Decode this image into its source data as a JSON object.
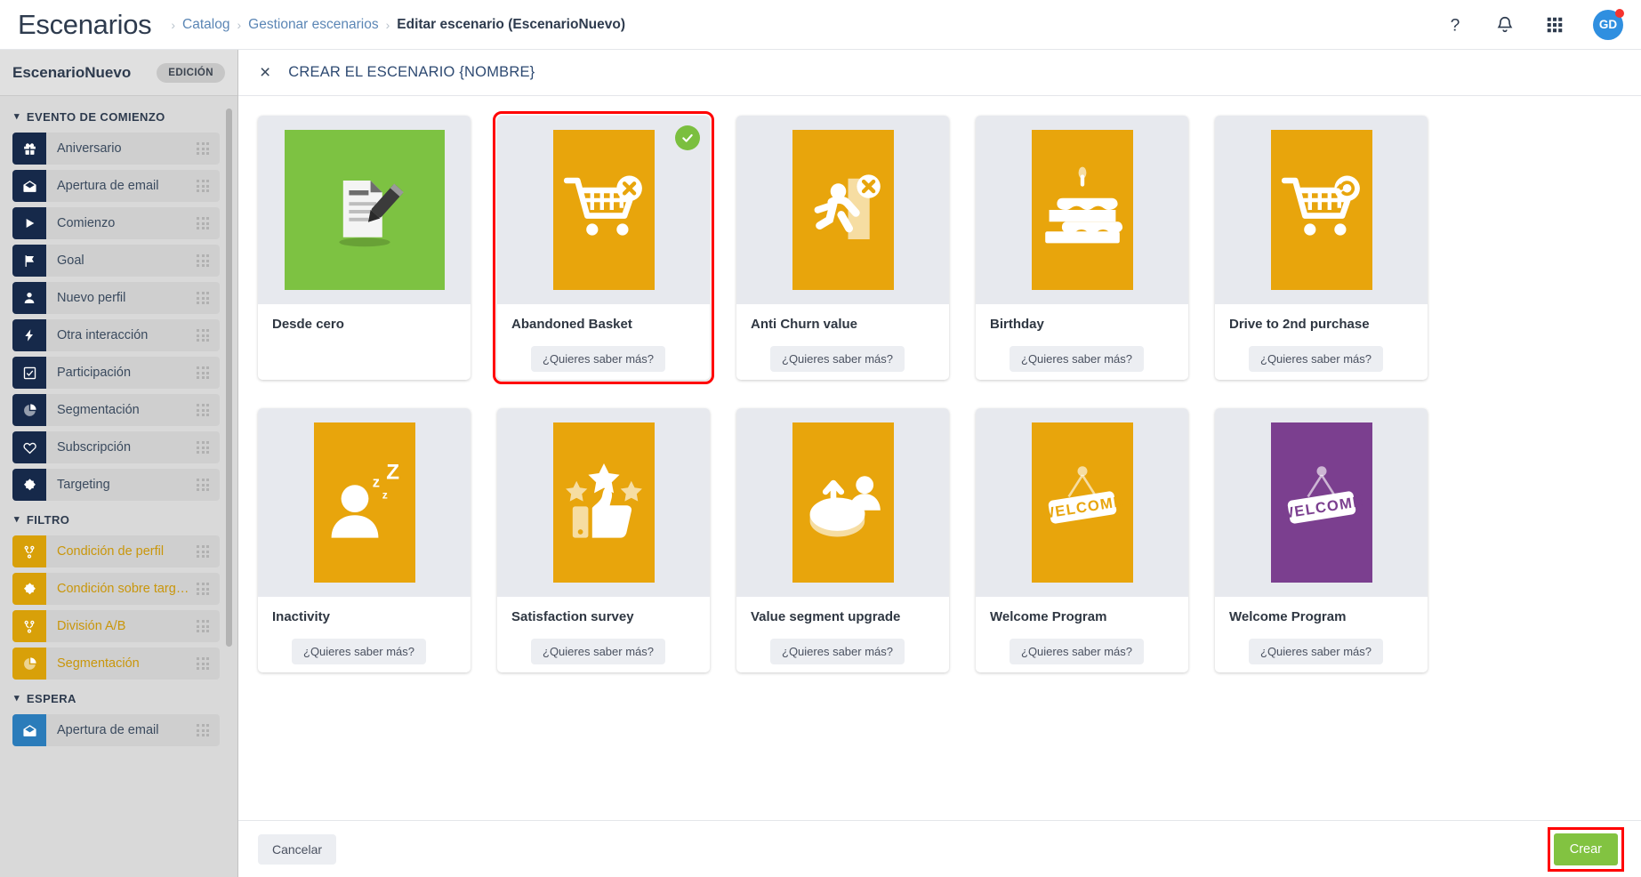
{
  "header": {
    "app_title": "Escenarios",
    "breadcrumb": [
      {
        "label": "Catalog",
        "active": false
      },
      {
        "label": "Gestionar escenarios",
        "active": false
      },
      {
        "label": "Editar escenario (EscenarioNuevo)",
        "active": true
      }
    ],
    "separator": "›",
    "actions": [
      {
        "name": "help-icon",
        "glyph": "?"
      },
      {
        "name": "notifications-bell-icon",
        "glyph": "bell"
      },
      {
        "name": "app-grid-icon",
        "glyph": "grid"
      }
    ],
    "avatar": {
      "initials": "GD",
      "color": "#2f8fe0",
      "dot_color": "#f6332e"
    }
  },
  "sidebar": {
    "scenario_name": "EscenarioNuevo",
    "edition_badge": "EDICIÓN",
    "groups": [
      {
        "title": "EVENTO DE COMIENZO",
        "kind": "evt",
        "items": [
          {
            "label": "Aniversario",
            "icon": "gift-icon"
          },
          {
            "label": "Apertura de email",
            "icon": "envelope-open-icon"
          },
          {
            "label": "Comienzo",
            "icon": "play-icon"
          },
          {
            "label": "Goal",
            "icon": "flag-icon"
          },
          {
            "label": "Nuevo perfil",
            "icon": "person-icon"
          },
          {
            "label": "Otra interacción",
            "icon": "bolt-icon"
          },
          {
            "label": "Participación",
            "icon": "checkbox-icon"
          },
          {
            "label": "Segmentación",
            "icon": "pie-chart-icon"
          },
          {
            "label": "Subscripción",
            "icon": "heart-icon"
          },
          {
            "label": "Targeting",
            "icon": "target-icon"
          }
        ]
      },
      {
        "title": "FILTRO",
        "kind": "flt",
        "items": [
          {
            "label": "Condición de perfil",
            "icon": "branch-icon"
          },
          {
            "label": "Condición sobre targeti...",
            "icon": "target-icon"
          },
          {
            "label": "División A/B",
            "icon": "branch-icon"
          },
          {
            "label": "Segmentación",
            "icon": "pie-chart-icon"
          }
        ]
      },
      {
        "title": "ESPERA",
        "kind": "esp",
        "items": [
          {
            "label": "Apertura de email",
            "icon": "envelope-open-icon"
          }
        ]
      }
    ]
  },
  "panel": {
    "close_label": "×",
    "title": "CREAR EL ESCENARIO {NOMBRE}",
    "more_label": "¿Quieres saber más?",
    "cancel_label": "Cancelar",
    "create_label": "Crear",
    "cards": [
      {
        "title": "Desde cero",
        "icon": "document-pencil-icon",
        "bg": "#7dc242",
        "selected": false,
        "has_more": false,
        "wide": true
      },
      {
        "title": "Abandoned Basket",
        "icon": "cart-x-icon",
        "bg": "#e8a50c",
        "selected": true,
        "has_more": true,
        "wide": false
      },
      {
        "title": "Anti Churn value",
        "icon": "person-exit-x-icon",
        "bg": "#e8a50c",
        "selected": false,
        "has_more": true,
        "wide": false
      },
      {
        "title": "Birthday",
        "icon": "cake-icon",
        "bg": "#e8a50c",
        "selected": false,
        "has_more": true,
        "wide": false
      },
      {
        "title": "Drive to 2nd purchase",
        "icon": "cart-refresh-icon",
        "bg": "#e8a50c",
        "selected": false,
        "has_more": true,
        "wide": false
      },
      {
        "title": "Inactivity",
        "icon": "sleeping-person-icon",
        "bg": "#e8a50c",
        "selected": false,
        "has_more": true,
        "wide": false
      },
      {
        "title": "Satisfaction survey",
        "icon": "thumbs-up-stars-icon",
        "bg": "#e8a50c",
        "selected": false,
        "has_more": true,
        "wide": false
      },
      {
        "title": "Value segment upgrade",
        "icon": "pie-upgrade-person-icon",
        "bg": "#e8a50c",
        "selected": false,
        "has_more": true,
        "wide": false
      },
      {
        "title": "Welcome Program",
        "icon": "welcome-sign-icon",
        "bg": "#e8a50c",
        "selected": false,
        "has_more": true,
        "wide": false
      },
      {
        "title": "Welcome Program",
        "icon": "welcome-sign-icon",
        "bg": "#7b3f8f",
        "selected": false,
        "has_more": true,
        "wide": false
      }
    ]
  },
  "colors": {
    "event_icon": "#16294a",
    "filter_icon": "#d8a009",
    "wait_icon": "#2b7cba",
    "accent_green": "#82c341",
    "highlight_red": "#ff0000",
    "selected_check": "#7bbf3f"
  }
}
